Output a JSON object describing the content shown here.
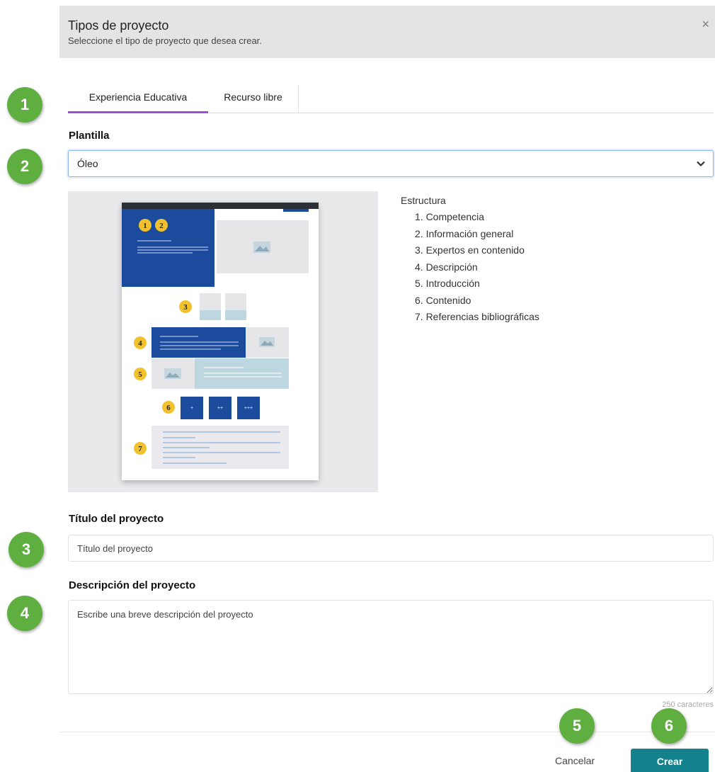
{
  "dialog": {
    "title": "Tipos de proyecto",
    "subtitle": "Seleccione el tipo de proyecto que desea crear.",
    "close": "×"
  },
  "tabs": [
    {
      "label": "Experiencia Educativa",
      "active": true
    },
    {
      "label": "Recurso libre",
      "active": false
    }
  ],
  "template": {
    "label": "Plantilla",
    "selected": "Óleo"
  },
  "preview": {
    "badges": [
      "1",
      "2",
      "3",
      "4",
      "5",
      "6",
      "7"
    ],
    "buttons": [
      "+",
      "++",
      "+++"
    ]
  },
  "structure": {
    "title": "Estructura",
    "items": [
      "1. Competencia",
      "2. Información general",
      "3. Expertos en contenido",
      "4. Descripción",
      "5. Introducción",
      "6. Contenido",
      "7. Referencias bibliográficas"
    ]
  },
  "project_title": {
    "label": "Título del proyecto",
    "placeholder": "Título del proyecto"
  },
  "project_description": {
    "label": "Descripción del proyecto",
    "placeholder": "Escribe una breve descripción del proyecto",
    "counter": "250 caracteres"
  },
  "buttons": {
    "cancel": "Cancelar",
    "create": "Crear"
  },
  "markers": [
    "1",
    "2",
    "3",
    "4",
    "5",
    "6"
  ],
  "colors": {
    "tab_active": "#9c4fd6",
    "primary": "#13828c",
    "marker": "#5fae40",
    "template_blue": "#1c4a9c",
    "badge_yellow": "#f2c12e"
  }
}
